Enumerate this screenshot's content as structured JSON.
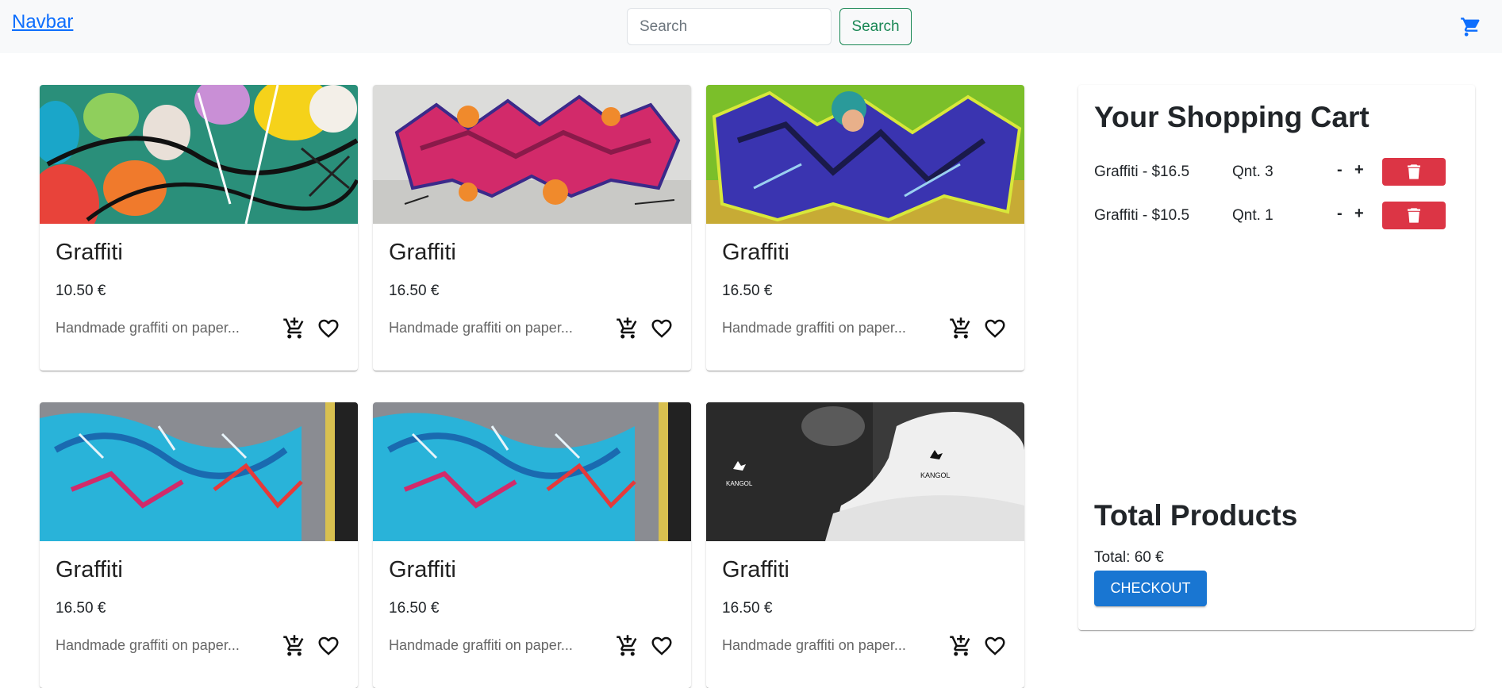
{
  "navbar": {
    "brand": "Navbar",
    "search_placeholder": "Search",
    "search_button": "Search",
    "cart_icon": "shopping-cart-icon"
  },
  "products": [
    {
      "title": "Graffiti",
      "price": "10.50 €",
      "description": "Handmade graffiti on paper..."
    },
    {
      "title": "Graffiti",
      "price": "16.50 €",
      "description": "Handmade graffiti on paper..."
    },
    {
      "title": "Graffiti",
      "price": "16.50 €",
      "description": "Handmade graffiti on paper..."
    },
    {
      "title": "Graffiti",
      "price": "16.50 €",
      "description": "Handmade graffiti on paper..."
    },
    {
      "title": "Graffiti",
      "price": "16.50 €",
      "description": "Handmade graffiti on paper..."
    },
    {
      "title": "Graffiti",
      "price": "16.50 €",
      "description": "Handmade graffiti on paper..."
    }
  ],
  "cart": {
    "title": "Your Shopping Cart",
    "items": [
      {
        "name": "Graffiti - $16.5",
        "qty": "Qnt. 3",
        "minus": "-",
        "plus": "+"
      },
      {
        "name": "Graffiti - $10.5",
        "qty": "Qnt. 1",
        "minus": "-",
        "plus": "+"
      }
    ],
    "total_title": "Total Products",
    "total_text": "Total: 60 €",
    "checkout_label": "CHECKOUT"
  },
  "colors": {
    "brand": "#0d6efd",
    "search_button": "#198754",
    "delete": "#dc3545",
    "checkout": "#1976d2"
  }
}
